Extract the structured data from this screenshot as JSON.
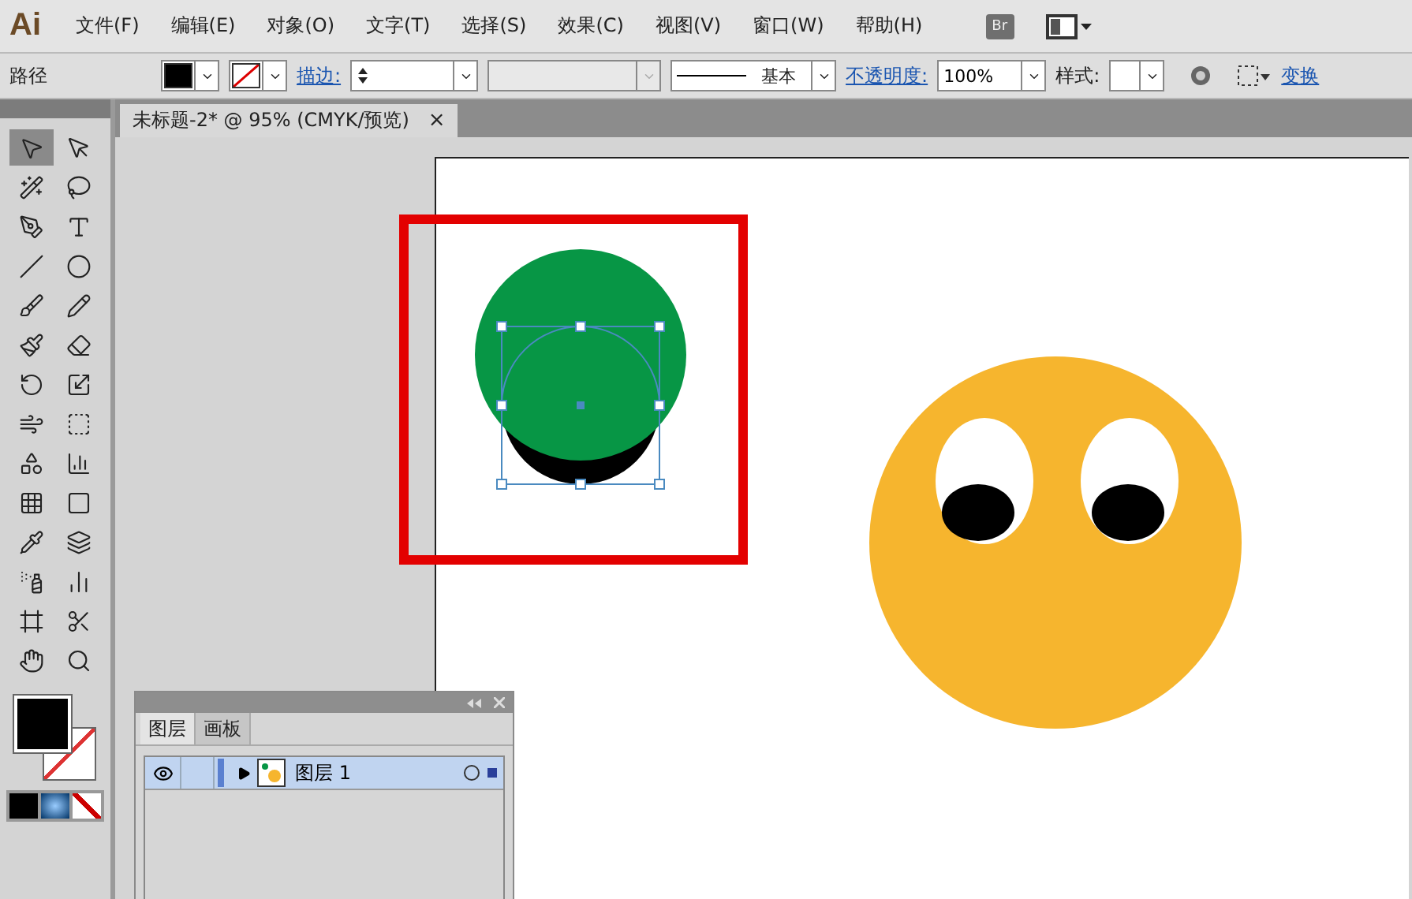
{
  "menu_bar": {
    "logo": "Ai",
    "items": [
      "文件(F)",
      "编辑(E)",
      "对象(O)",
      "文字(T)",
      "选择(S)",
      "效果(C)",
      "视图(V)",
      "窗口(W)",
      "帮助(H)"
    ],
    "bridge": "Br"
  },
  "control_bar": {
    "object_type": "路径",
    "stroke_link": "描边:",
    "stroke_style": "基本",
    "opacity_link": "不透明度:",
    "opacity": "100%",
    "style_label": "样式:",
    "transform_link": "变换"
  },
  "document_tab": {
    "title": "未标题-2* @ 95% (CMYK/预览)",
    "close": "×"
  },
  "tools": [
    {
      "kind": "select",
      "selected": true
    },
    {
      "kind": "direct",
      "selected": false
    },
    {
      "kind": "wand",
      "selected": false
    },
    {
      "kind": "lasso",
      "selected": false
    },
    {
      "kind": "pen",
      "selected": false
    },
    {
      "kind": "type",
      "selected": false
    },
    {
      "kind": "line",
      "selected": false
    },
    {
      "kind": "ellipse",
      "selected": false
    },
    {
      "kind": "brush",
      "selected": false
    },
    {
      "kind": "pencil",
      "selected": false
    },
    {
      "kind": "blob",
      "selected": false
    },
    {
      "kind": "eraser",
      "selected": false
    },
    {
      "kind": "rotate",
      "selected": false
    },
    {
      "kind": "scale",
      "selected": false
    },
    {
      "kind": "warp",
      "selected": false
    },
    {
      "kind": "freetransform",
      "selected": false
    },
    {
      "kind": "shapebuilder",
      "selected": false
    },
    {
      "kind": "graph3d",
      "selected": false
    },
    {
      "kind": "mesh",
      "selected": false
    },
    {
      "kind": "gradient",
      "selected": false
    },
    {
      "kind": "eyedropper",
      "selected": false
    },
    {
      "kind": "blend",
      "selected": false
    },
    {
      "kind": "spray",
      "selected": false
    },
    {
      "kind": "graph",
      "selected": false
    },
    {
      "kind": "artboard",
      "selected": false
    },
    {
      "kind": "slice",
      "selected": false
    },
    {
      "kind": "hand",
      "selected": false
    },
    {
      "kind": "zoom",
      "selected": false
    }
  ],
  "layers_panel": {
    "tabs": [
      {
        "label": "图层",
        "selected": true
      },
      {
        "label": "画板",
        "selected": false
      }
    ],
    "layers": [
      {
        "name": "图层 1",
        "visible": true,
        "selected": true
      }
    ]
  }
}
